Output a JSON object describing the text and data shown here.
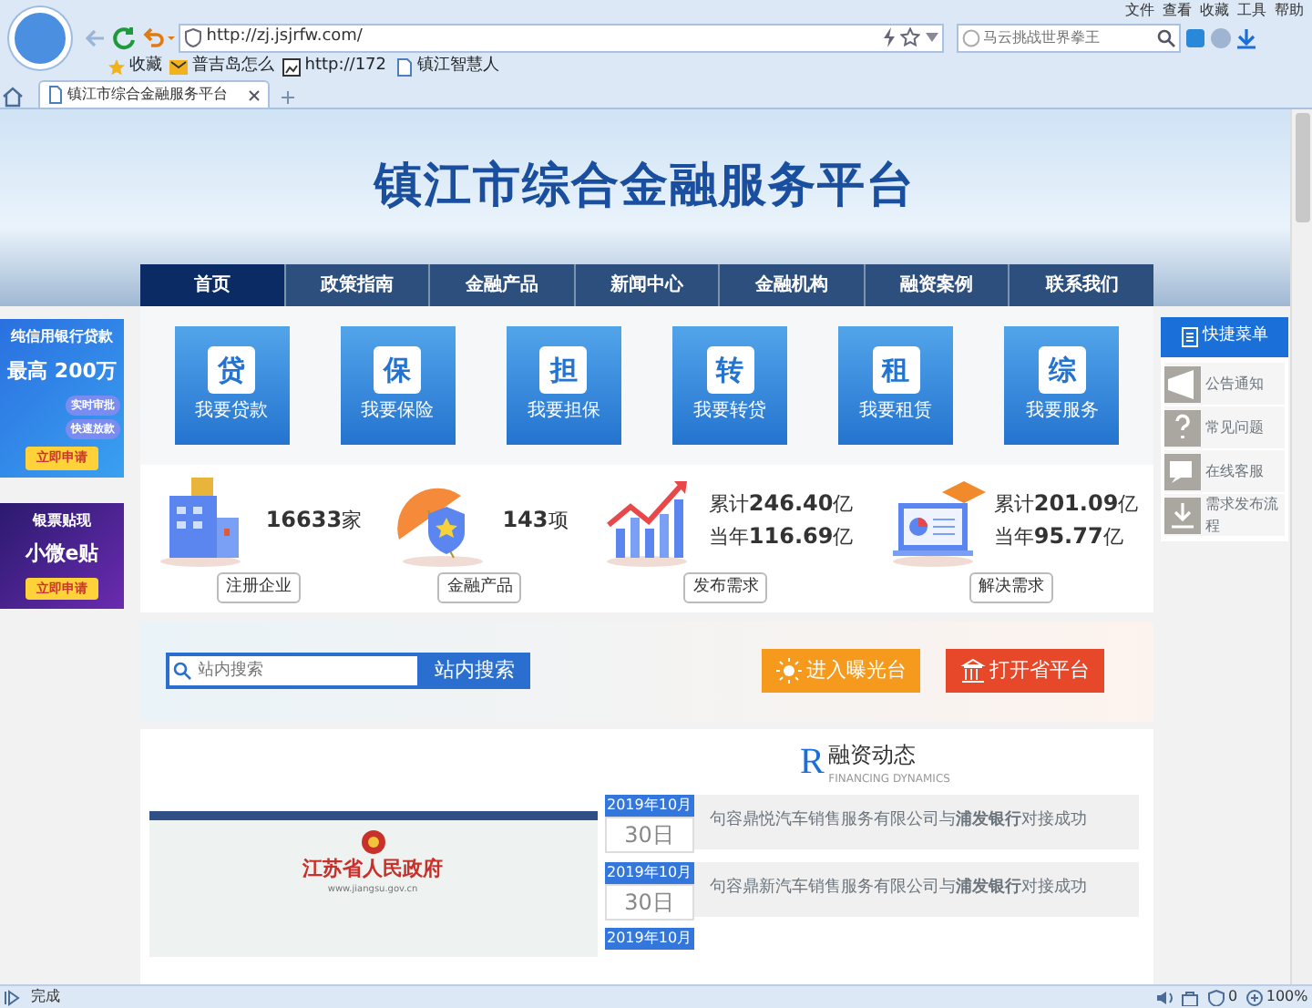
{
  "browser": {
    "menu": [
      "文件",
      "查看",
      "收藏",
      "工具",
      "帮助"
    ],
    "url": "http://zj.jsjrfw.com/",
    "search_placeholder": "马云挑战世界拳王",
    "bookmarks": [
      {
        "label": "收藏",
        "kind": "star"
      },
      {
        "label": "普吉岛怎么",
        "kind": "mail"
      },
      {
        "label": "http://172",
        "kind": "image"
      },
      {
        "label": "镇江智慧人",
        "kind": "page"
      }
    ],
    "tabs": [
      {
        "label": "镇江市综合金融服务平台",
        "selected": true
      }
    ],
    "status": "完成",
    "blocked_count": "0",
    "zoom": "100%"
  },
  "site": {
    "title": "镇江市综合金融服务平台",
    "nav": [
      {
        "label": "首页",
        "selected": true
      },
      {
        "label": "政策指南",
        "selected": false
      },
      {
        "label": "金融产品",
        "selected": false
      },
      {
        "label": "新闻中心",
        "selected": false
      },
      {
        "label": "金融机构",
        "selected": false
      },
      {
        "label": "融资案例",
        "selected": false
      },
      {
        "label": "联系我们",
        "selected": false
      }
    ],
    "ads": [
      {
        "kind": "loan",
        "lines": [
          "纯信用银行贷款",
          "最高 200万"
        ],
        "tags": [
          "实时审批",
          "快速放款"
        ],
        "button": "立即申请"
      },
      {
        "kind": "bill",
        "lines": [
          "银票贴现",
          "小微e贴"
        ],
        "button": "立即申请"
      }
    ],
    "services": [
      {
        "glyph": "贷",
        "label": "我要贷款"
      },
      {
        "glyph": "保",
        "label": "我要保险"
      },
      {
        "glyph": "担",
        "label": "我要担保"
      },
      {
        "glyph": "转",
        "label": "我要转贷"
      },
      {
        "glyph": "租",
        "label": "我要租赁"
      },
      {
        "glyph": "综",
        "label": "我要服务"
      }
    ],
    "stats": [
      {
        "kind": "building",
        "lines": [
          "**16633**家"
        ],
        "label": "注册企业"
      },
      {
        "kind": "umbrella",
        "lines": [
          "**143**项"
        ],
        "label": "金融产品"
      },
      {
        "kind": "chart",
        "lines": [
          "累计**246.40**亿",
          "当年**116.69**亿"
        ],
        "label": "发布需求"
      },
      {
        "kind": "laptop",
        "lines": [
          "累计**201.09**亿",
          "当年**95.77**亿"
        ],
        "label": "解决需求"
      }
    ],
    "search": {
      "placeholder": "站内搜索",
      "button": "站内搜索"
    },
    "links": [
      {
        "kind": "exposure",
        "label": "进入曝光台"
      },
      {
        "kind": "province",
        "label": "打开省平台"
      }
    ],
    "embedded_site": {
      "title": "江苏省人民政府",
      "url": "www.jiangsu.gov.cn"
    },
    "news": {
      "letter": "R",
      "title": "融资动态",
      "subtitle": "FINANCING DYNAMICS",
      "items": [
        {
          "month": "2019年10月",
          "day": "30日",
          "text": "句容鼎悦汽车销售服务有限公司与**浦发银行**对接成功"
        },
        {
          "month": "2019年10月",
          "day": "30日",
          "text": "句容鼎新汽车销售服务有限公司与**浦发银行**对接成功"
        },
        {
          "month": "2019年10月"
        }
      ]
    },
    "quick_menu": {
      "title": "快捷菜单",
      "items": [
        {
          "kind": "notice",
          "label": "公告通知"
        },
        {
          "kind": "faq",
          "label": "常见问题"
        },
        {
          "kind": "chat",
          "label": "在线客服"
        },
        {
          "kind": "download",
          "label": "需求发布流程"
        }
      ]
    }
  }
}
